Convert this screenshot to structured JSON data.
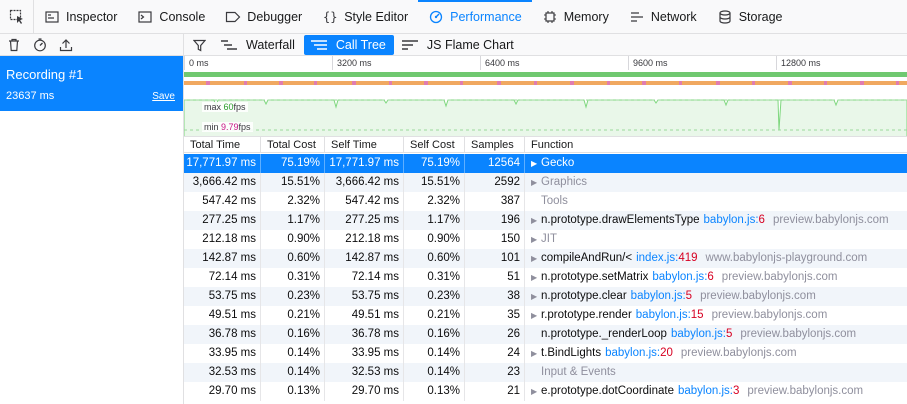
{
  "tabs": [
    {
      "label": "Inspector",
      "icon": "inspector-icon"
    },
    {
      "label": "Console",
      "icon": "console-icon"
    },
    {
      "label": "Debugger",
      "icon": "debugger-icon"
    },
    {
      "label": "Style Editor",
      "icon": "style-editor-icon"
    },
    {
      "label": "Performance",
      "icon": "performance-icon",
      "selected": true
    },
    {
      "label": "Memory",
      "icon": "memory-icon"
    },
    {
      "label": "Network",
      "icon": "network-icon"
    },
    {
      "label": "Storage",
      "icon": "storage-icon"
    }
  ],
  "views": {
    "waterfall": "Waterfall",
    "call_tree": "Call Tree",
    "flame_chart": "JS Flame Chart",
    "selected": "call_tree"
  },
  "recording": {
    "name": "Recording #1",
    "duration": "23637 ms",
    "save_label": "Save"
  },
  "overview": {
    "ruler": [
      "0 ms",
      "3200 ms",
      "6400 ms",
      "9600 ms",
      "12800 ms"
    ],
    "fps_max_prefix": "max ",
    "fps_max_value": "60",
    "fps_min_prefix": "min ",
    "fps_min_value": "9.79",
    "fps_unit": "fps"
  },
  "columns": {
    "total_time": "Total Time",
    "total_cost": "Total Cost",
    "self_time": "Self Time",
    "self_cost": "Self Cost",
    "samples": "Samples",
    "function": "Function"
  },
  "rows": [
    {
      "total_time": "17,771.97 ms",
      "total_cost": "75.19%",
      "self_time": "17,771.97 ms",
      "self_cost": "75.19%",
      "samples": "12564",
      "fn": "Gecko",
      "file": "",
      "line": "",
      "host": "",
      "twisty": true,
      "category": true,
      "selected": true
    },
    {
      "total_time": "3,666.42 ms",
      "total_cost": "15.51%",
      "self_time": "3,666.42 ms",
      "self_cost": "15.51%",
      "samples": "2592",
      "fn": "Graphics",
      "file": "",
      "line": "",
      "host": "",
      "twisty": true,
      "category": true
    },
    {
      "total_time": "547.42 ms",
      "total_cost": "2.32%",
      "self_time": "547.42 ms",
      "self_cost": "2.32%",
      "samples": "387",
      "fn": "Tools",
      "file": "",
      "line": "",
      "host": "",
      "twisty": false,
      "category": true
    },
    {
      "total_time": "277.25 ms",
      "total_cost": "1.17%",
      "self_time": "277.25 ms",
      "self_cost": "1.17%",
      "samples": "196",
      "fn": "n.prototype.drawElementsType",
      "file": "babylon.js",
      "line": "6",
      "host": "preview.babylonjs.com",
      "twisty": true,
      "category": false
    },
    {
      "total_time": "212.18 ms",
      "total_cost": "0.90%",
      "self_time": "212.18 ms",
      "self_cost": "0.90%",
      "samples": "150",
      "fn": "JIT",
      "file": "",
      "line": "",
      "host": "",
      "twisty": true,
      "category": true
    },
    {
      "total_time": "142.87 ms",
      "total_cost": "0.60%",
      "self_time": "142.87 ms",
      "self_cost": "0.60%",
      "samples": "101",
      "fn": "compileAndRun/<",
      "file": "index.js",
      "line": "419",
      "host": "www.babylonjs-playground.com",
      "twisty": true,
      "category": false
    },
    {
      "total_time": "72.14 ms",
      "total_cost": "0.31%",
      "self_time": "72.14 ms",
      "self_cost": "0.31%",
      "samples": "51",
      "fn": "n.prototype.setMatrix",
      "file": "babylon.js",
      "line": "6",
      "host": "preview.babylonjs.com",
      "twisty": true,
      "category": false
    },
    {
      "total_time": "53.75 ms",
      "total_cost": "0.23%",
      "self_time": "53.75 ms",
      "self_cost": "0.23%",
      "samples": "38",
      "fn": "n.prototype.clear",
      "file": "babylon.js",
      "line": "5",
      "host": "preview.babylonjs.com",
      "twisty": true,
      "category": false
    },
    {
      "total_time": "49.51 ms",
      "total_cost": "0.21%",
      "self_time": "49.51 ms",
      "self_cost": "0.21%",
      "samples": "35",
      "fn": "r.prototype.render",
      "file": "babylon.js",
      "line": "15",
      "host": "preview.babylonjs.com",
      "twisty": true,
      "category": false
    },
    {
      "total_time": "36.78 ms",
      "total_cost": "0.16%",
      "self_time": "36.78 ms",
      "self_cost": "0.16%",
      "samples": "26",
      "fn": "n.prototype._renderLoop",
      "file": "babylon.js",
      "line": "5",
      "host": "preview.babylonjs.com",
      "twisty": false,
      "category": false
    },
    {
      "total_time": "33.95 ms",
      "total_cost": "0.14%",
      "self_time": "33.95 ms",
      "self_cost": "0.14%",
      "samples": "24",
      "fn": "t.BindLights",
      "file": "babylon.js",
      "line": "20",
      "host": "preview.babylonjs.com",
      "twisty": true,
      "category": false
    },
    {
      "total_time": "32.53 ms",
      "total_cost": "0.14%",
      "self_time": "32.53 ms",
      "self_cost": "0.14%",
      "samples": "23",
      "fn": "Input & Events",
      "file": "",
      "line": "",
      "host": "",
      "twisty": false,
      "category": true
    },
    {
      "total_time": "29.70 ms",
      "total_cost": "0.13%",
      "self_time": "29.70 ms",
      "self_cost": "0.13%",
      "samples": "21",
      "fn": "e.prototype.dotCoordinate",
      "file": "babylon.js",
      "line": "3",
      "host": "preview.babylonjs.com",
      "twisty": true,
      "category": false
    }
  ],
  "colors": {
    "accent": "#0a84ff",
    "fps_graph": "#7fd77f",
    "marker_green": "#70c870",
    "marker_orange": "#f0a860",
    "marker_pink": "#e07cb0"
  }
}
